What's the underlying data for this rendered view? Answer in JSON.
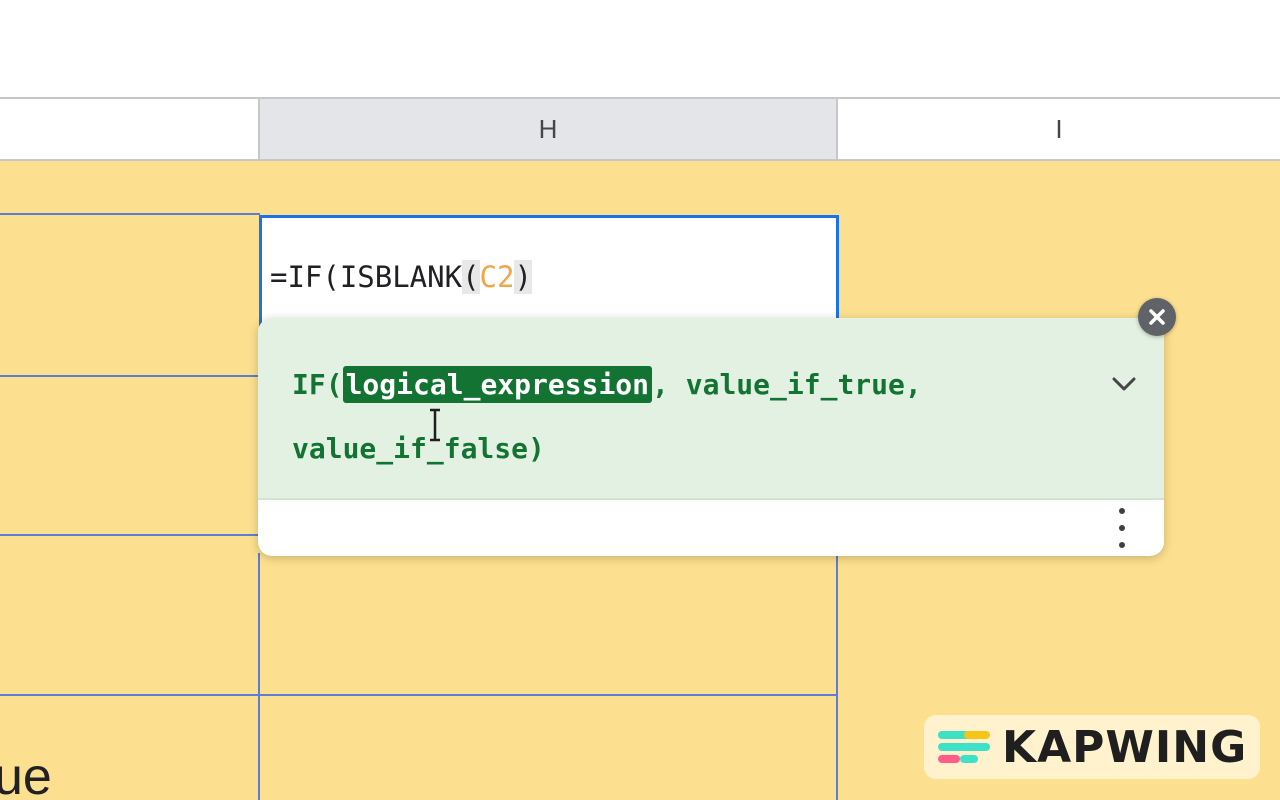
{
  "spreadsheet": {
    "columns": [
      "H",
      "I"
    ],
    "partial_cell_text": "ue",
    "colors": {
      "cell_fill": "#fde08f",
      "grid_line": "#5b7fd6",
      "selection_border": "#1a73e8",
      "cell_ref": "#f0a64b"
    }
  },
  "editor": {
    "formula_prefix": "=IF(ISBLANK",
    "formula_open_paren": "(",
    "formula_ref": "C2",
    "formula_close_paren": ")"
  },
  "function_hint": {
    "fn_open": "IF(",
    "active_arg": "logical_expression",
    "rest_line1": ", value_if_true,",
    "line2": "value_if_false)",
    "icons": {
      "expand": "chevron-down-icon",
      "more": "more-vert-icon",
      "close": "close-icon"
    },
    "colors": {
      "background": "#e3f1e2",
      "text": "#137333",
      "highlight_bg": "#137333"
    }
  },
  "watermark": {
    "text": "KAPWING",
    "colors": [
      "#3ee0c8",
      "#f5c518",
      "#ff5c8a"
    ]
  }
}
